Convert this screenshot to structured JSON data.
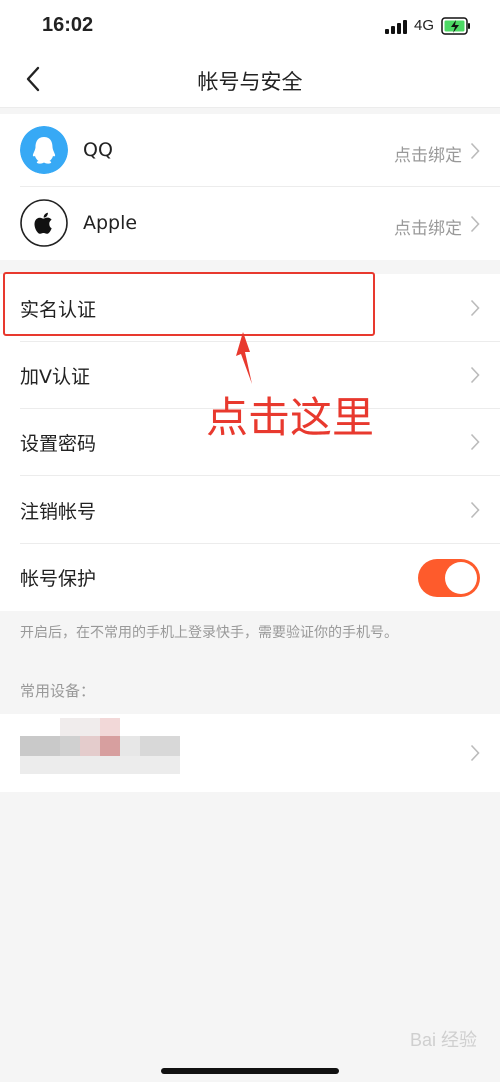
{
  "status": {
    "time": "16:02",
    "network": "4G"
  },
  "header": {
    "title": "帐号与安全"
  },
  "bindings": [
    {
      "name": "QQ",
      "action": "点击绑定"
    },
    {
      "name": "Apple",
      "action": "点击绑定"
    }
  ],
  "settings": {
    "real_name": "实名认证",
    "verify_v": "加V认证",
    "set_password": "设置密码",
    "deactivate": "注销帐号",
    "protection": "帐号保护",
    "protection_enabled": true,
    "protection_hint": "开启后，在不常用的手机上登录快手，需要验证你的手机号。"
  },
  "devices": {
    "heading": "常用设备："
  },
  "annotation": {
    "text": "点击这里"
  },
  "watermark": {
    "text": "Bai 经验"
  },
  "colors": {
    "accent": "#fe5b2c",
    "qq": "#37a9f5",
    "annotation": "#e8392e"
  }
}
